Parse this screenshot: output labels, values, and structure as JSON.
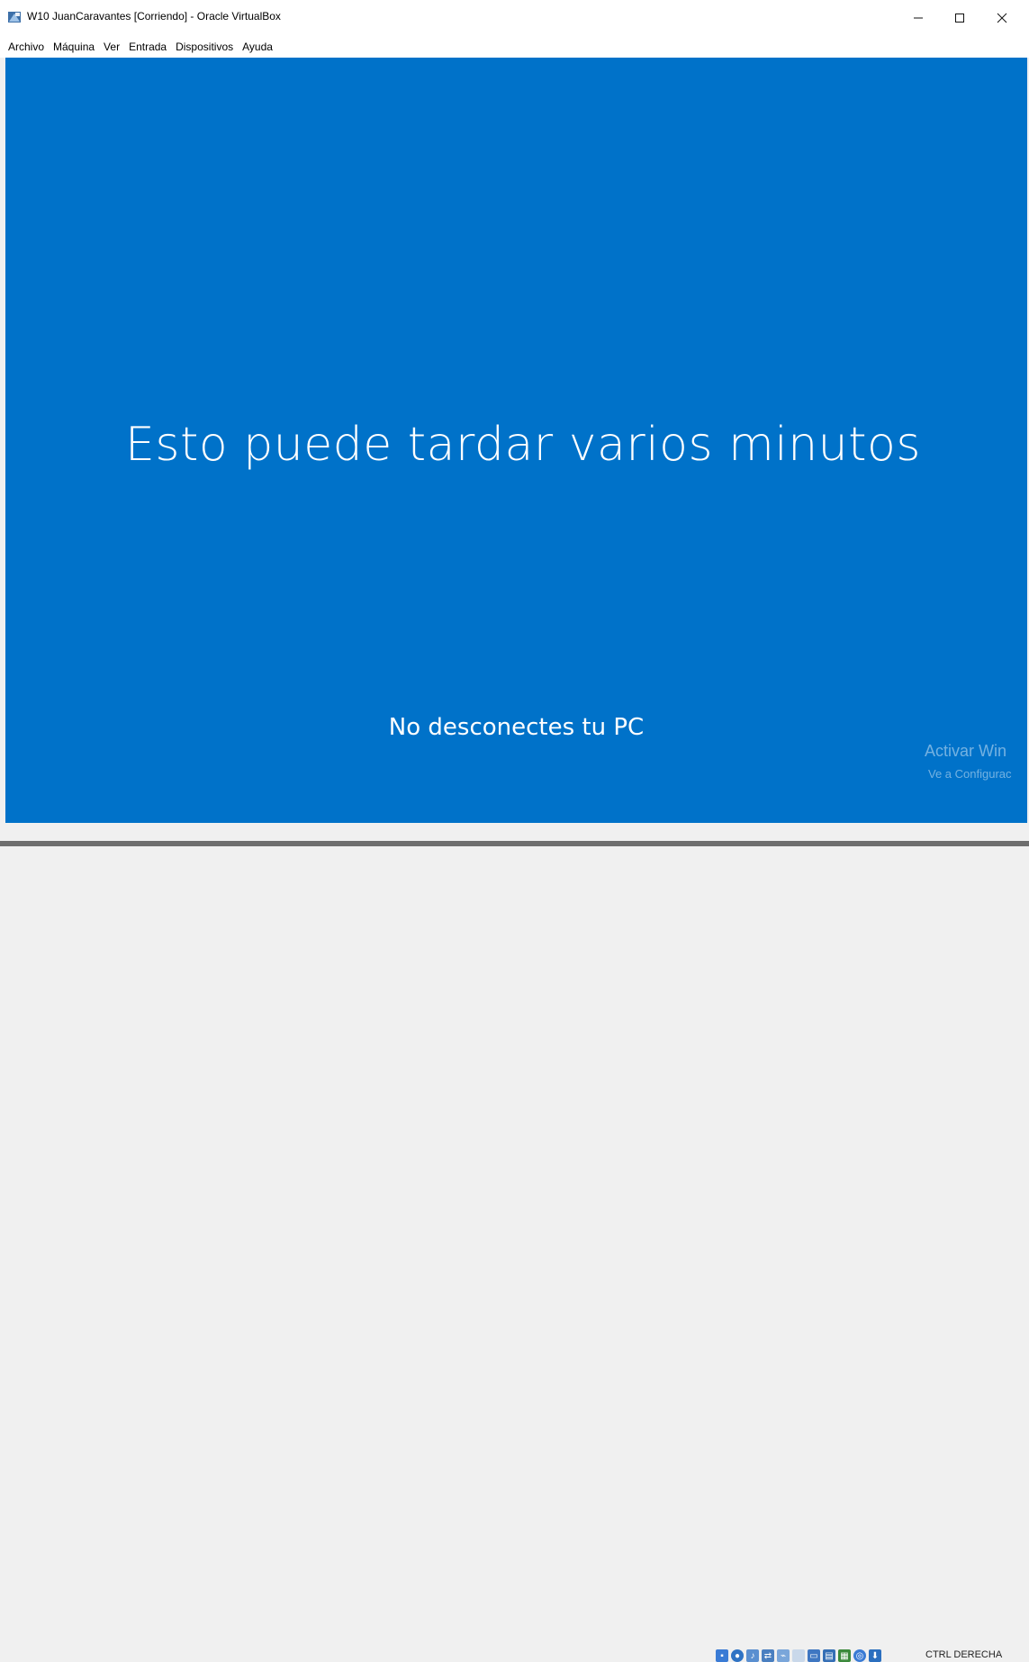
{
  "window": {
    "title": "W10 JuanCaravantes [Corriendo] - Oracle VirtualBox",
    "minimize_glyph": "—",
    "maximize_glyph": "☐",
    "close_glyph": "✕"
  },
  "menu": {
    "items": [
      {
        "label": "Archivo"
      },
      {
        "label": "Máquina"
      },
      {
        "label": "Ver"
      },
      {
        "label": "Entrada"
      },
      {
        "label": "Dispositivos"
      },
      {
        "label": "Ayuda"
      }
    ]
  },
  "guest_screen": {
    "background_color": "#0072c9",
    "main_message": "Esto puede tardar varios minutos",
    "sub_message": "No desconectes tu PC",
    "activation_watermark": {
      "line1": "Activar Win",
      "line2": "Ve a Configurac"
    }
  },
  "statusbar": {
    "icons": [
      "hard-disk-icon",
      "optical-drive-icon",
      "audio-icon",
      "network-icon",
      "usb-icon",
      "shared-folders-icon",
      "display-icon",
      "video-capture-icon",
      "cpu-activity-icon",
      "mouse-integration-icon",
      "host-key-icon"
    ],
    "host_key_label": "CTRL DERECHA"
  }
}
